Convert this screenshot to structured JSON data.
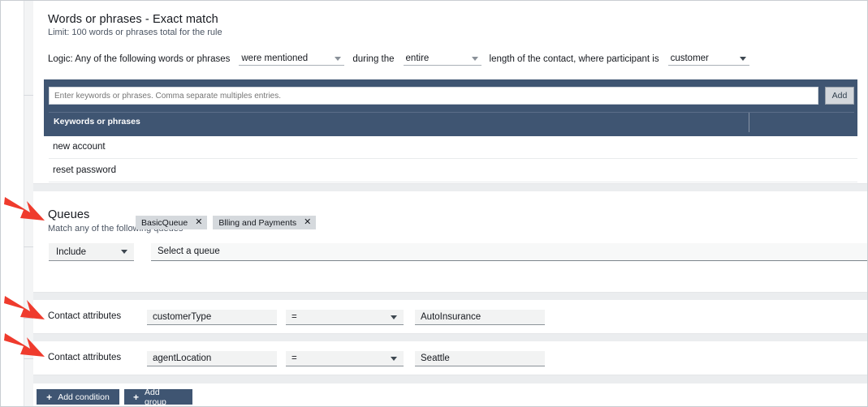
{
  "words_section": {
    "title": "Words or phrases - Exact match",
    "subtitle": "Limit: 100 words or phrases total for the rule",
    "logic": {
      "prefix": "Logic: Any of the following words or phrases",
      "mentioned_value": "were mentioned",
      "mid_text": "during the",
      "duration_value": "entire",
      "suffix": "length of the contact, where participant is",
      "participant_value": "customer"
    },
    "keyword_input_placeholder": "Enter keywords or phrases. Comma separate multiples entries.",
    "keyword_input_value": "",
    "add_label": "Add",
    "table_header": "Keywords or phrases",
    "rows": [
      "new account",
      "reset password"
    ]
  },
  "queues_section": {
    "title": "Queues",
    "subtitle": "Match any of the following queues",
    "include_value": "Include",
    "queue_placeholder": "Select a queue",
    "tags": [
      "BasicQueue",
      "Blling and Payments"
    ],
    "tag_remove_glyph": "✕"
  },
  "contact_attributes": [
    {
      "label": "Contact attributes",
      "key": "customerType",
      "operator": "=",
      "value": "AutoInsurance"
    },
    {
      "label": "Contact attributes",
      "key": "agentLocation",
      "operator": "=",
      "value": "Seattle"
    }
  ],
  "footer": {
    "add_condition_label": "Add condition",
    "add_group_label": "Add group",
    "plus_glyph": "+"
  },
  "colors": {
    "navy": "#3f5572",
    "annotation_red": "#ef3b2d",
    "page_background": "#ebedef",
    "field_fill": "#f2f3f3",
    "tag_fill": "#d5d9dd"
  }
}
